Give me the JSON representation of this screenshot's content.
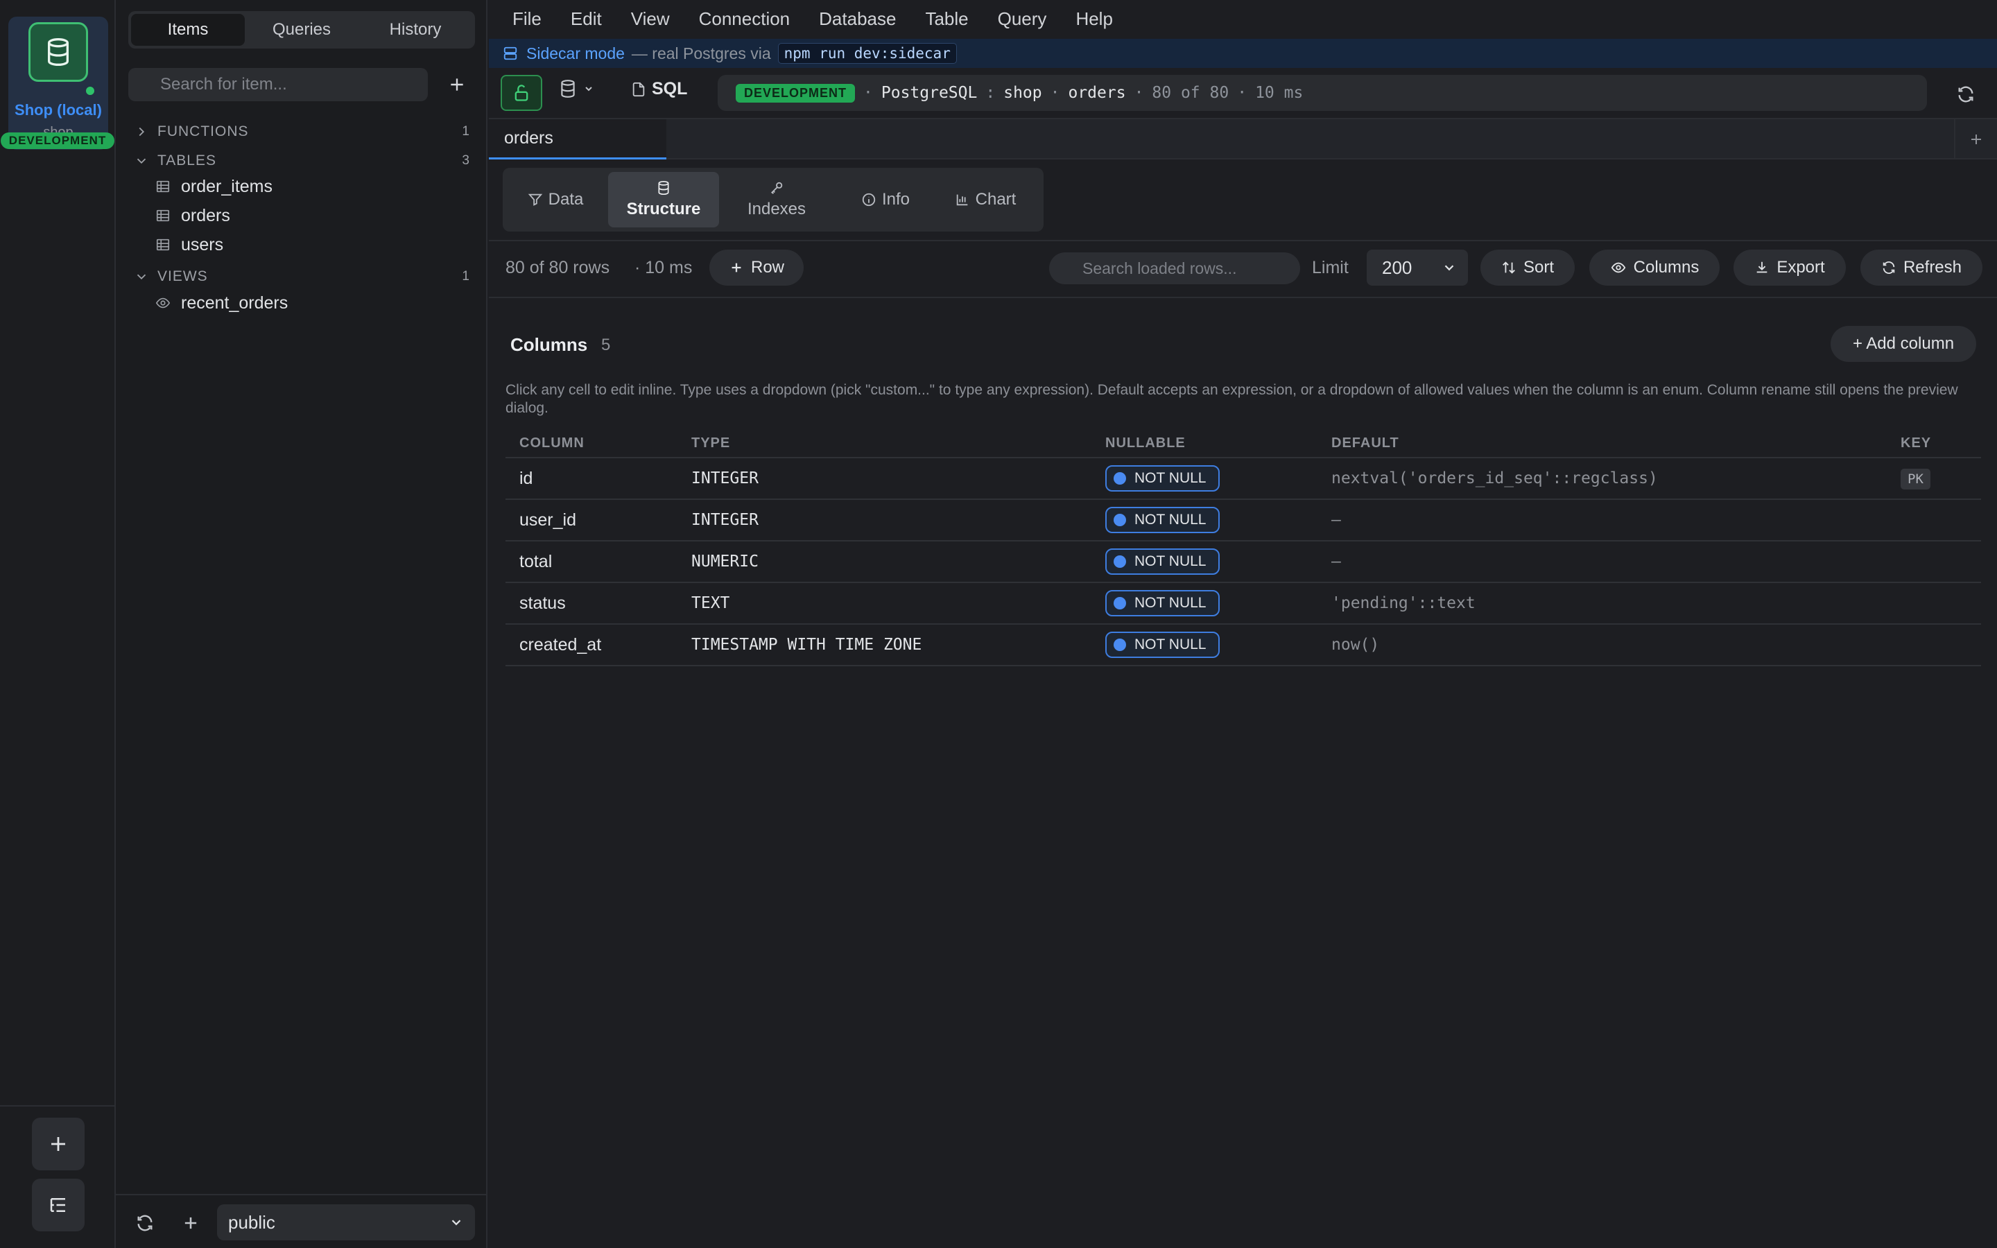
{
  "rail": {
    "connection_name": "Shop (local)",
    "connection_db": "shop",
    "env": "DEVELOPMENT"
  },
  "sidebar": {
    "tabs": [
      "Items",
      "Queries",
      "History"
    ],
    "active_tab": "Items",
    "search_placeholder": "Search for item...",
    "sections": [
      {
        "label": "FUNCTIONS",
        "count": "1"
      },
      {
        "label": "TABLES",
        "count": "3"
      },
      {
        "label": "VIEWS",
        "count": "1"
      }
    ],
    "tables": [
      "order_items",
      "orders",
      "users"
    ],
    "views": [
      "recent_orders"
    ],
    "schema": "public"
  },
  "menu": [
    "File",
    "Edit",
    "View",
    "Connection",
    "Database",
    "Table",
    "Query",
    "Help"
  ],
  "banner": {
    "title": "Sidecar mode",
    "subtitle": "— real Postgres via",
    "command": "npm run dev:sidecar"
  },
  "toolbar": {
    "sql_label": "SQL",
    "env": "DEVELOPMENT",
    "engine": "PostgreSQL",
    "colon": ":",
    "database": "shop",
    "dot": "·",
    "table": "orders",
    "rows": "80 of 80",
    "time": "10 ms"
  },
  "doc_tab": "orders",
  "view_tabs": {
    "data": "Data",
    "structure": "Structure",
    "indexes": "Indexes",
    "info": "Info",
    "chart": "Chart"
  },
  "data_toolbar": {
    "row_count": "80 of 80 rows",
    "row_time": "· 10 ms",
    "add_row": "Row",
    "search_placeholder": "Search loaded rows...",
    "limit_label": "Limit",
    "limit_value": "200",
    "sort": "Sort",
    "columns": "Columns",
    "export": "Export",
    "refresh": "Refresh"
  },
  "structure": {
    "title": "Columns",
    "count": "5",
    "add_column": "+ Add column",
    "help": "Click any cell to edit inline. Type uses a dropdown (pick \"custom...\" to type any expression). Default accepts an expression, or a dropdown of allowed values when the column is an enum. Column rename still opens the preview dialog.",
    "headers": {
      "column": "COLUMN",
      "type": "TYPE",
      "nullable": "NULLABLE",
      "default": "DEFAULT",
      "key": "KEY"
    },
    "rows": [
      {
        "column": "id",
        "type": "INTEGER",
        "nullable": "NOT NULL",
        "default": "nextval('orders_id_seq'::regclass)",
        "key": "PK"
      },
      {
        "column": "user_id",
        "type": "INTEGER",
        "nullable": "NOT NULL",
        "default": "—",
        "key": ""
      },
      {
        "column": "total",
        "type": "NUMERIC",
        "nullable": "NOT NULL",
        "default": "—",
        "key": ""
      },
      {
        "column": "status",
        "type": "TEXT",
        "nullable": "NOT NULL",
        "default": "'pending'::text",
        "key": ""
      },
      {
        "column": "created_at",
        "type": "TIMESTAMP WITH TIME ZONE",
        "nullable": "NOT NULL",
        "default": "now()",
        "key": ""
      }
    ]
  },
  "colors": {
    "accent": "#3e8ef7",
    "env_green": "#22a855",
    "background": "#1d1e22"
  }
}
